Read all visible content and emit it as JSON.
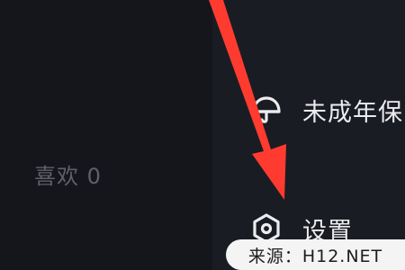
{
  "left_pane": {
    "likes_label": "喜欢 0"
  },
  "drawer": {
    "items": [
      {
        "label": "未成年保",
        "icon": "umbrella-icon"
      },
      {
        "label": "设置",
        "icon": "settings-hexagon-icon"
      }
    ]
  },
  "watermark": {
    "text": "来源：H12.NET"
  },
  "colors": {
    "background": "#121319",
    "drawer_background": "#1a1c23",
    "arrow": "#ff3b30",
    "watermark_bg": "#f4f4f4"
  }
}
